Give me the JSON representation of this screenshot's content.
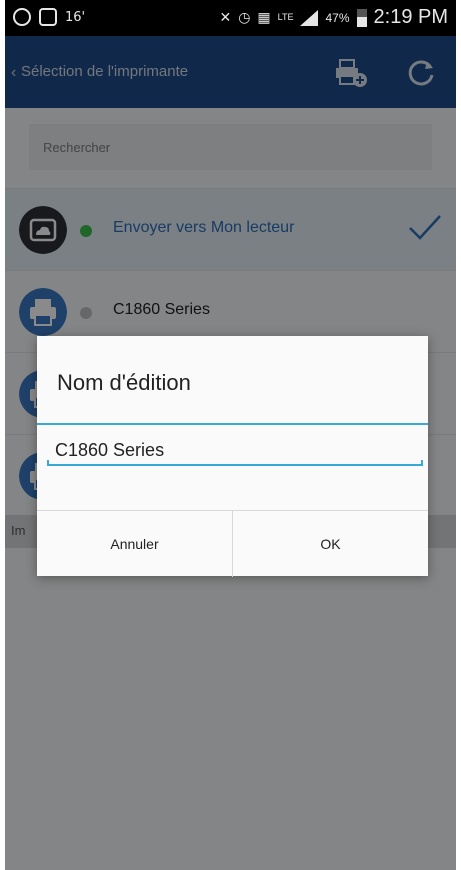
{
  "status_bar": {
    "notification_count": "16'",
    "network": "LTE",
    "battery": "47%",
    "time": "2:19 PM"
  },
  "header": {
    "title": "Sélection de l'imprimante",
    "icons": [
      "add-printer-icon",
      "refresh-icon"
    ]
  },
  "search": {
    "placeholder": "Rechercher"
  },
  "printers": [
    {
      "name": "Envoyer vers Mon lecteur",
      "status_color": "#3dbd4c",
      "selected": true,
      "icon": "cloud-drive-icon"
    },
    {
      "name": "C1860 Series",
      "status_color": "#bfbfbf",
      "selected": false,
      "icon": "printer-icon"
    },
    {
      "name": "",
      "icon": "printer-icon"
    },
    {
      "name": "",
      "icon": "printer-icon"
    }
  ],
  "section_label": "Im",
  "dialog": {
    "title": "Nom d'édition",
    "input_value": "C1860 Series",
    "cancel_label": "Annuler",
    "ok_label": "OK"
  },
  "colors": {
    "header_bg": "#1f4a87",
    "accent": "#39a7d8",
    "selected_row": "#e3ecf6"
  }
}
